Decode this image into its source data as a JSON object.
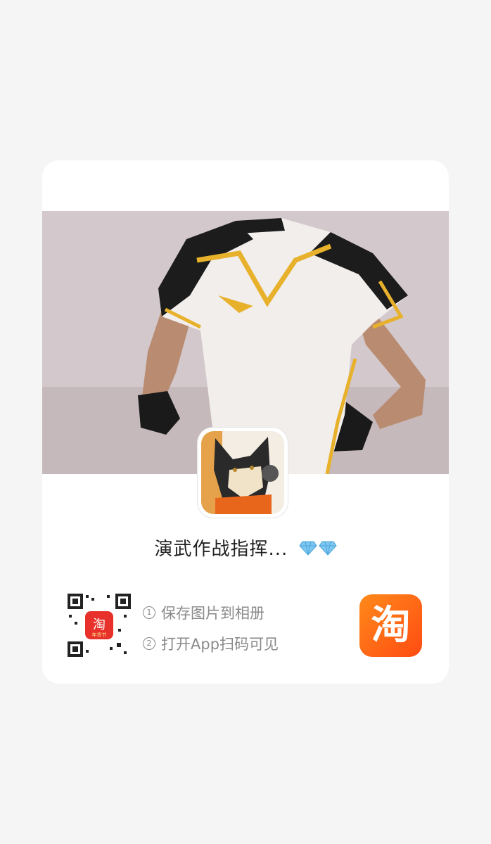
{
  "card": {
    "title": "演武作战指挥...",
    "diamond_count": 2
  },
  "steps": [
    {
      "num": "1",
      "text": "保存图片到相册"
    },
    {
      "num": "2",
      "text": "打开App扫码可见"
    }
  ],
  "qr": {
    "center_logo": "淘",
    "center_sub": "年货节"
  },
  "app_icon": {
    "glyph": "淘"
  },
  "colors": {
    "page_bg": "#f5f5f5",
    "taobao_orange": "#ff5a14",
    "diamond_blue": "#7fc6f0"
  }
}
